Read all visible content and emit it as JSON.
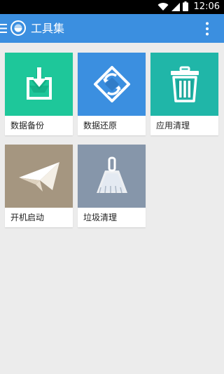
{
  "status_bar": {
    "time": "12:06"
  },
  "app_bar": {
    "title": "工具集"
  },
  "tiles": [
    {
      "label": "数据备份",
      "color": "#1ec79a",
      "icon": "download-tray-icon"
    },
    {
      "label": "数据还原",
      "color": "#3b8fe0",
      "icon": "restore-icon"
    },
    {
      "label": "应用清理",
      "color": "#20b6a8",
      "icon": "trash-can-icon"
    },
    {
      "label": "开机启动",
      "color": "#a59680",
      "icon": "paper-plane-icon"
    },
    {
      "label": "垃圾清理",
      "color": "#8696aa",
      "icon": "broom-icon"
    }
  ],
  "colors": {
    "app_bar": "#3b8fe0",
    "background": "#ececec"
  }
}
